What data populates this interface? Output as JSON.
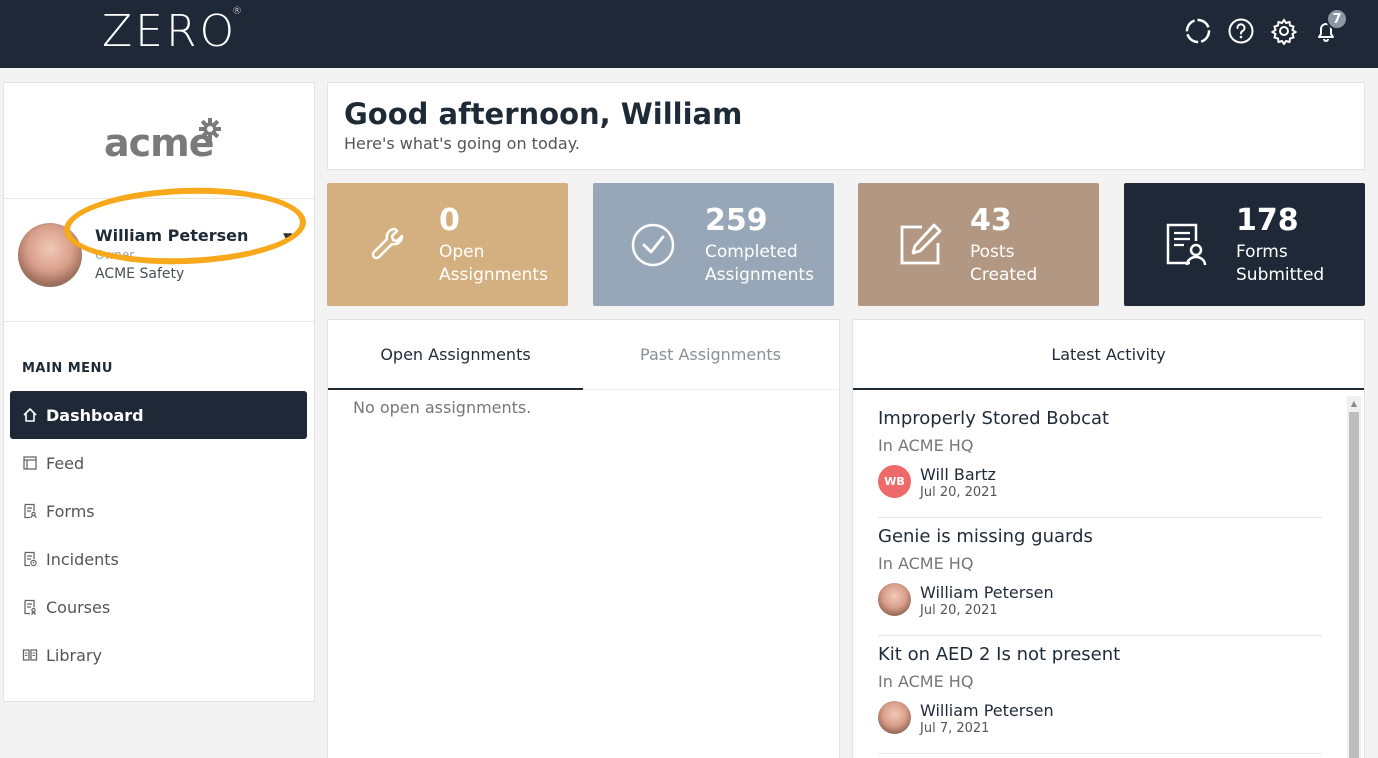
{
  "topbar": {
    "logo": "ZERO",
    "logo_mark": "®",
    "icons": [
      "loading-icon",
      "help-icon",
      "gear-icon",
      "bell-icon"
    ],
    "notification_count": "7",
    "colors": {
      "background": "#1e2837"
    }
  },
  "sidebar": {
    "brand": "acme",
    "profile": {
      "name": "William Petersen",
      "role": "Owner",
      "org": "ACME Safety"
    },
    "menu_heading": "MAIN MENU",
    "items": [
      {
        "label": "Dashboard",
        "icon": "home-icon",
        "active": true
      },
      {
        "label": "Feed",
        "icon": "feed-icon",
        "active": false
      },
      {
        "label": "Forms",
        "icon": "forms-icon",
        "active": false
      },
      {
        "label": "Incidents",
        "icon": "incidents-icon",
        "active": false
      },
      {
        "label": "Courses",
        "icon": "courses-icon",
        "active": false
      },
      {
        "label": "Library",
        "icon": "library-icon",
        "active": false
      }
    ]
  },
  "greeting": {
    "title": "Good afternoon, William",
    "subtitle": "Here's what's going on today."
  },
  "stats": [
    {
      "value": "0",
      "line1": "Open",
      "line2": "Assignments",
      "icon": "wrench-icon",
      "color": "#d4b080"
    },
    {
      "value": "259",
      "line1": "Completed",
      "line2": "Assignments",
      "icon": "check-circle-icon",
      "color": "#97a7b8"
    },
    {
      "value": "43",
      "line1": "Posts",
      "line2": "Created",
      "icon": "edit-icon",
      "color": "#b29882"
    },
    {
      "value": "178",
      "line1": "Forms",
      "line2": "Submitted",
      "icon": "form-user-icon",
      "color": "#1e2837"
    }
  ],
  "assignments": {
    "tabs": [
      "Open Assignments",
      "Past Assignments"
    ],
    "empty_text": "No open assignments."
  },
  "activity": {
    "heading": "Latest Activity",
    "items": [
      {
        "title": "Improperly Stored Bobcat",
        "location": "In ACME HQ",
        "user": "Will Bartz",
        "initials": "WB",
        "date": "Jul 20, 2021"
      },
      {
        "title": "Genie is missing guards",
        "location": "In ACME HQ",
        "user": "William Petersen",
        "date": "Jul 20, 2021"
      },
      {
        "title": "Kit on AED 2 Is not present",
        "location": "In ACME HQ",
        "user": "William Petersen",
        "date": "Jul 7, 2021"
      }
    ]
  }
}
